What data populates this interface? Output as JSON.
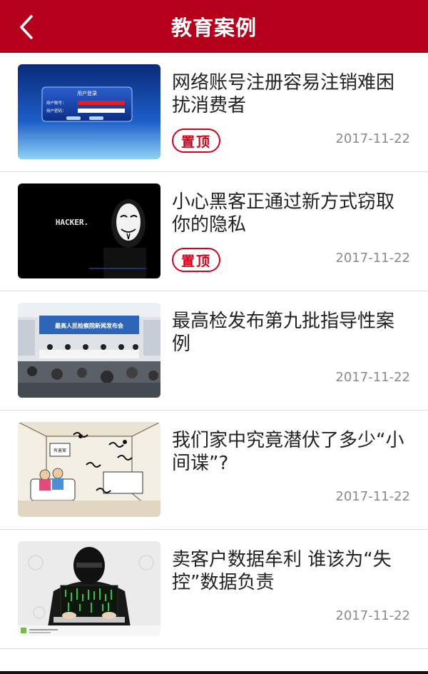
{
  "header": {
    "title": "教育案例",
    "back_icon": "chevron-left-icon",
    "color": "#b5001c"
  },
  "articles": [
    {
      "title": "网络账号注册容易注销难困扰消费者",
      "badge": "置顶",
      "date": "2017-11-22",
      "thumb_text": "用户登录",
      "thumb_label_account": "用户账号：",
      "thumb_label_password": "用户密码："
    },
    {
      "title": "小心黑客正通过新方式窃取你的隐私",
      "badge": "置顶",
      "date": "2017-11-22",
      "thumb_text": "HACKER."
    },
    {
      "title": "最高检发布第九批指导性案例",
      "date": "2017-11-22",
      "thumb_text": "最高人民检察院新闻发布会"
    },
    {
      "title": "我们家中究竟潜伏了多少“小间谍”?",
      "date": "2017-11-22",
      "thumb_text": "有害案"
    },
    {
      "title": "卖客户数据牟利 谁该为“失控”数据负责",
      "date": "2017-11-22"
    }
  ],
  "colors": {
    "badge": "#d0021b",
    "date": "#8a8a8a",
    "title": "#222222"
  }
}
